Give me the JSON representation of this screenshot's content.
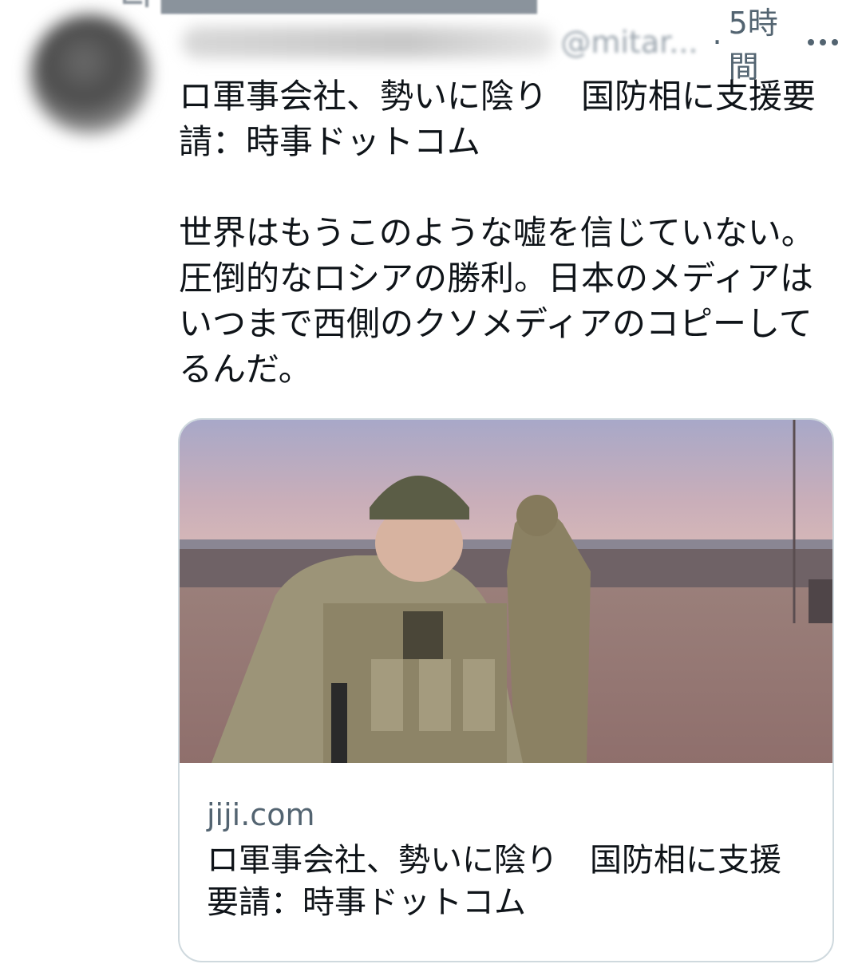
{
  "tweet": {
    "time": "5時間",
    "dot": "·",
    "handle": "@mitar...",
    "text": "ロ軍事会社、勢いに陰り　国防相に支援要請：時事ドットコム\n\n世界はもうこのような嘘を信じていない。圧倒的なロシアの勝利。日本のメディアはいつまで西側のクソメディアのコピーしてるんだ。"
  },
  "card": {
    "domain": "jiji.com",
    "title": "ロ軍事会社、勢いに陰り　国防相に支援要請：時事ドットコム"
  },
  "icons": {
    "retweet": "retweet-icon",
    "more": "more-icon"
  },
  "colors": {
    "secondary_text": "#536471",
    "border": "#cfd9de"
  }
}
